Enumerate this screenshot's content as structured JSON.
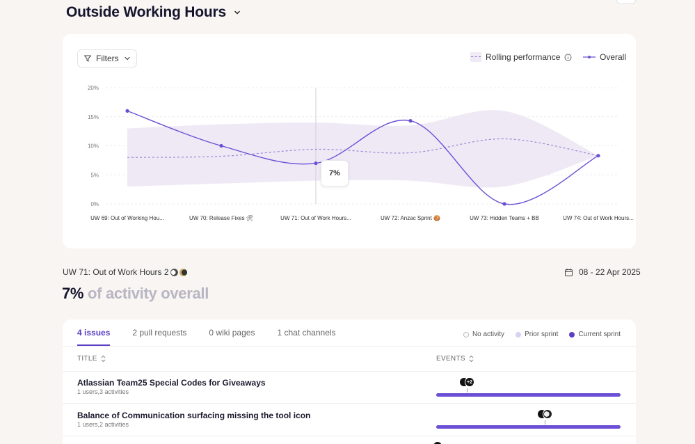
{
  "page": {
    "title": "Outside Working Hours"
  },
  "chart_card": {
    "filters_label": "Filters",
    "legend": {
      "rolling": "Rolling performance",
      "overall": "Overall"
    },
    "tooltip_value": "7%"
  },
  "chart_data": {
    "type": "line",
    "categories": [
      "UW 69: Out of Working Hou...",
      "UW 70: Release Fixes 🛠",
      "UW 71: Out of Work Hours...",
      "UW 72: Anzac Sprint 🍪",
      "UW 73: Hidden Teams + BB",
      "UW 74: Out of Work Hours..."
    ],
    "y_ticks": [
      "20%",
      "15%",
      "10%",
      "5%",
      "0%"
    ],
    "ylim": [
      0,
      20
    ],
    "series": [
      {
        "name": "Overall",
        "values": [
          16,
          10,
          7,
          14.3,
          0,
          8.3
        ]
      },
      {
        "name": "Rolling performance",
        "values": [
          8,
          8.2,
          9.4,
          8.8,
          11.2,
          8.3
        ],
        "band_low": [
          3,
          3.5,
          4,
          4,
          3,
          8.3
        ],
        "band_high": [
          13,
          13.7,
          14,
          13.5,
          16,
          8.3
        ]
      }
    ],
    "grid": true,
    "colors": {
      "overall": "#6b4fd4",
      "rolling": "#9a87d0",
      "band": "#efe9f6"
    }
  },
  "detail": {
    "sprint_name": "UW 71: Out of Work Hours 2",
    "date_range": "08 - 22 Apr 2025",
    "summary_pct": "7%",
    "summary_rest": " of activity overall"
  },
  "table": {
    "tabs": [
      "4 issues",
      "2 pull requests",
      "0 wiki pages",
      "1 chat channels"
    ],
    "key": {
      "no_activity": "No activity",
      "prior_sprint": "Prior sprint",
      "current_sprint": "Current sprint"
    },
    "columns": {
      "title": "TITLE",
      "events": "EVENTS"
    },
    "rows": [
      {
        "title": "Atlassian Team25 Special Codes for Giveaways",
        "sub": "1 users,3 activities",
        "more_badge": "+2"
      },
      {
        "title": "Balance of Communication surfacing missing the tool icon",
        "sub": "1 users,2 activities"
      }
    ]
  }
}
